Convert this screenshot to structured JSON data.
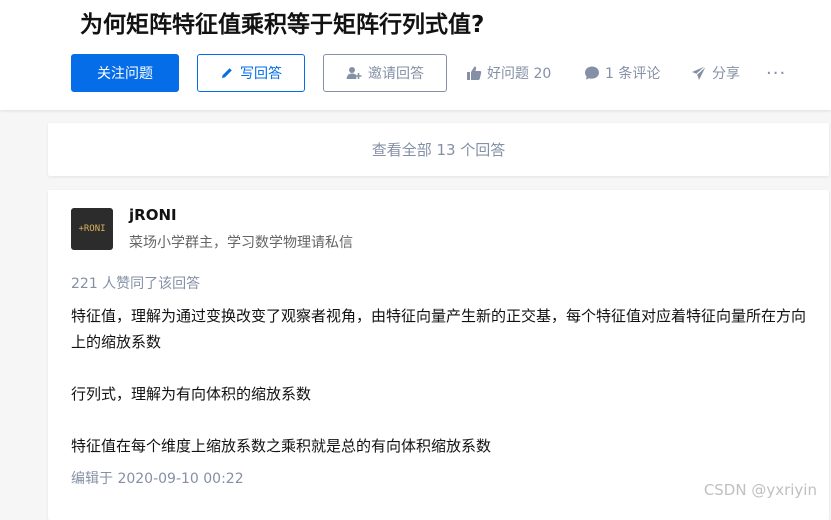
{
  "question": {
    "title": "为何矩阵特征值乘积等于矩阵行列式值?"
  },
  "actions": {
    "follow_label": "关注问题",
    "write_label": "写回答",
    "invite_label": "邀请回答",
    "like_label": "好问题 20",
    "comment_label": "1 条评论",
    "share_label": "分享",
    "more_label": "···"
  },
  "view_all": {
    "label": "查看全部 13 个回答"
  },
  "answer": {
    "author": {
      "avatar_text": "+RONI",
      "name": "jRONI",
      "bio": "菜场小学群主，学习数学物理请私信"
    },
    "votes": "221 人赞同了该回答",
    "paragraphs": [
      "特征值，理解为通过变换改变了观察者视角，由特征向量产生新的正交基，每个特征值对应着特征向量所在方向上的缩放系数",
      "行列式，理解为有向体积的缩放系数",
      "特征值在每个维度上缩放系数之乘积就是总的有向体积缩放系数"
    ],
    "edited": "编辑于 2020-09-10 00:22"
  },
  "watermark": "CSDN @yxriyin",
  "colors": {
    "primary": "#056de8",
    "muted": "#8590a6",
    "text": "#121212",
    "background": "#f6f6f6"
  }
}
